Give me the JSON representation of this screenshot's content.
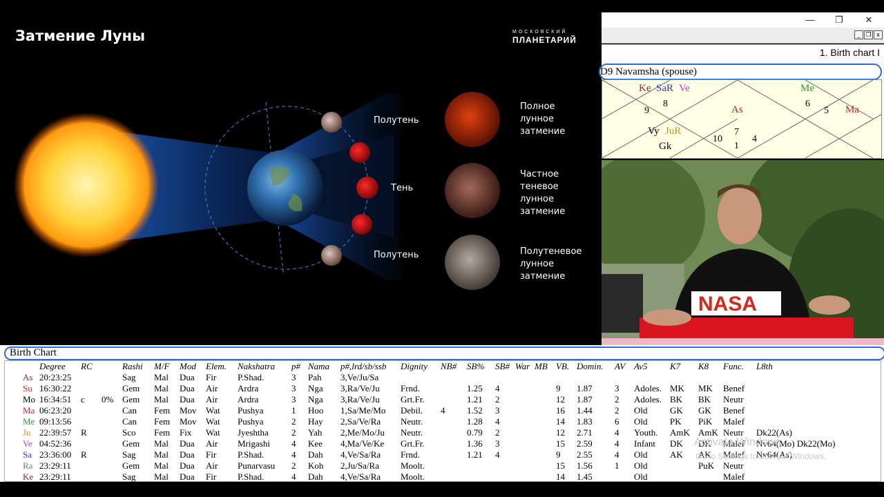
{
  "slide": {
    "title": "Затмение Луны",
    "logo_top": "МОСКОВСКИЙ",
    "logo_bottom": "ПЛАНЕТАРИЙ",
    "label_penumbra_top": "Полутень",
    "label_umbra": "Тень",
    "label_penumbra_bottom": "Полутень",
    "eclipse_total": [
      "Полное",
      "лунное",
      "затмение"
    ],
    "eclipse_partial": [
      "Частное",
      "теневое",
      "лунное",
      "затмение"
    ],
    "eclipse_penumbral": [
      "Полутеневое",
      "лунное",
      "затмение"
    ]
  },
  "window": {
    "minimize": "—",
    "maximize": "❐",
    "close": "✕",
    "mdi_min": "_",
    "mdi_restore": "❐",
    "mdi_close": "x",
    "tab_label": "1. Birth chart I"
  },
  "navamsha": {
    "title": "D9 Navamsha  (spouse)",
    "cells": {
      "ke": "Ke",
      "sar": "SaR",
      "ve": "Ve",
      "me": "Me",
      "as": "As",
      "ma": "Ma",
      "vy": "Vy",
      "jur": "JuR",
      "gk": "Gk"
    },
    "numbers": {
      "n8": "8",
      "n9": "9",
      "n6": "6",
      "n5": "5",
      "n7": "7",
      "n10": "10",
      "n4": "4",
      "n1": "1"
    },
    "colors": {
      "ke": "#8a2b2b",
      "sa": "#2a38c8",
      "ve": "#c83ad0",
      "me": "#2e9a36",
      "ma": "#c62828",
      "ju": "#d4901a"
    }
  },
  "table": {
    "title": "Birth Chart",
    "headers": [
      "Degree",
      "RC",
      "",
      "Rashi",
      "M/F",
      "Mod",
      "Elem.",
      "Nakshatra",
      "p#",
      "Nama",
      "p#,lrd/sb/ssb",
      "Dignity",
      "NB#",
      "SB%",
      "SB#",
      "War",
      "MB",
      "VB.",
      "Domin.",
      "AV",
      "Av5",
      "K7",
      "K8",
      "Func.",
      "L8th"
    ],
    "rows": [
      {
        "planet": "As",
        "color": "#8a2b2b",
        "cells": [
          "20:23:25",
          "",
          "",
          "Sag",
          "Mal",
          "Dua",
          "Fir",
          "P.Shad.",
          "3",
          "Pah",
          "3,Ve/Ju/Sa",
          "",
          "",
          "",
          "",
          "",
          "",
          "",
          "",
          "",
          "",
          "",
          "",
          "",
          ""
        ]
      },
      {
        "planet": "Su",
        "color": "#c62828",
        "cells": [
          "16:30:22",
          "",
          "",
          "Gem",
          "Mal",
          "Dua",
          "Air",
          "Ardra",
          "3",
          "Nga",
          "3,Ra/Ve/Ju",
          "Frnd.",
          "",
          "1.25",
          "4",
          "",
          "",
          "9",
          "1.87",
          "3",
          "Adoles.",
          "MK",
          "MK",
          "Benef",
          ""
        ]
      },
      {
        "planet": "Mo",
        "color": "#000000",
        "cells": [
          "16:34:51",
          "c",
          "0%",
          "Gem",
          "Mal",
          "Dua",
          "Air",
          "Ardra",
          "3",
          "Nga",
          "3,Ra/Ve/Ju",
          "Grt.Fr.",
          "",
          "1.21",
          "2",
          "",
          "",
          "12",
          "1.87",
          "2",
          "Adoles.",
          "BK",
          "BK",
          "Neutr",
          ""
        ]
      },
      {
        "planet": "Ma",
        "color": "#c62828",
        "cells": [
          "06:23:20",
          "",
          "",
          "Can",
          "Fem",
          "Mov",
          "Wat",
          "Pushya",
          "1",
          "Hoo",
          "1,Sa/Me/Mo",
          "Debil.",
          "4",
          "1.52",
          "3",
          "",
          "",
          "16",
          "1.44",
          "2",
          "Old",
          "GK",
          "GK",
          "Benef",
          ""
        ]
      },
      {
        "planet": "Me",
        "color": "#2e9a36",
        "cells": [
          "09:13:56",
          "",
          "",
          "Can",
          "Fem",
          "Mov",
          "Wat",
          "Pushya",
          "2",
          "Hay",
          "2,Sa/Ve/Ra",
          "Neutr.",
          "",
          "1.28",
          "4",
          "",
          "",
          "14",
          "1.83",
          "6",
          "Old",
          "PK",
          "PiK",
          "Malef",
          ""
        ]
      },
      {
        "planet": "Ju",
        "color": "#d4901a",
        "cells": [
          "22:39:57",
          "R",
          "",
          "Sco",
          "Fem",
          "Fix",
          "Wat",
          "Jyeshtha",
          "2",
          "Yah",
          "2,Me/Mo/Ju",
          "Neutr.",
          "",
          "0.79",
          "2",
          "",
          "",
          "12",
          "2.71",
          "4",
          "Youth.",
          "AmK",
          "AmK",
          "Neutr",
          "Dk22(As)"
        ]
      },
      {
        "planet": "Ve",
        "color": "#c83ad0",
        "cells": [
          "04:52:36",
          "",
          "",
          "Gem",
          "Mal",
          "Dua",
          "Air",
          "Mrigashi",
          "4",
          "Kee",
          "4,Ma/Ve/Ke",
          "Grt.Fr.",
          "",
          "1.36",
          "3",
          "",
          "",
          "15",
          "2.59",
          "4",
          "Infant",
          "DK",
          "DK",
          "Malef",
          "Nv64(Mo) Dk22(Mo)"
        ]
      },
      {
        "planet": "Sa",
        "color": "#2a38c8",
        "cells": [
          "23:36:00",
          "R",
          "",
          "Sag",
          "Mal",
          "Dua",
          "Fir",
          "P.Shad.",
          "4",
          "Dah",
          "4,Ve/Sa/Ra",
          "Frnd.",
          "",
          "1.21",
          "4",
          "",
          "",
          "9",
          "2.55",
          "4",
          "Old",
          "AK",
          "AK",
          "Malef",
          "Nv64(As)"
        ]
      },
      {
        "planet": "Ra",
        "color": "#777777",
        "cells": [
          "23:29:11",
          "",
          "",
          "Gem",
          "Mal",
          "Dua",
          "Air",
          "Punarvasu",
          "2",
          "Koh",
          "2,Ju/Sa/Ra",
          "Moolt.",
          "",
          "",
          "",
          "",
          "",
          "15",
          "1.56",
          "1",
          "Old",
          "",
          "PuK",
          "Neutr",
          ""
        ]
      },
      {
        "planet": "Ke",
        "color": "#8a2b2b",
        "cells": [
          "23:29:11",
          "",
          "",
          "Sag",
          "Mal",
          "Dua",
          "Fir",
          "P.Shad.",
          "4",
          "Dah",
          "4,Ve/Sa/Ra",
          "Moolt.",
          "",
          "",
          "",
          "",
          "",
          "14",
          "1.45",
          "",
          "Old",
          "",
          "",
          "Malef",
          ""
        ]
      }
    ]
  },
  "watermark": {
    "line1": "Activate Windows",
    "line2": "Go to Settings to activate Windows."
  }
}
